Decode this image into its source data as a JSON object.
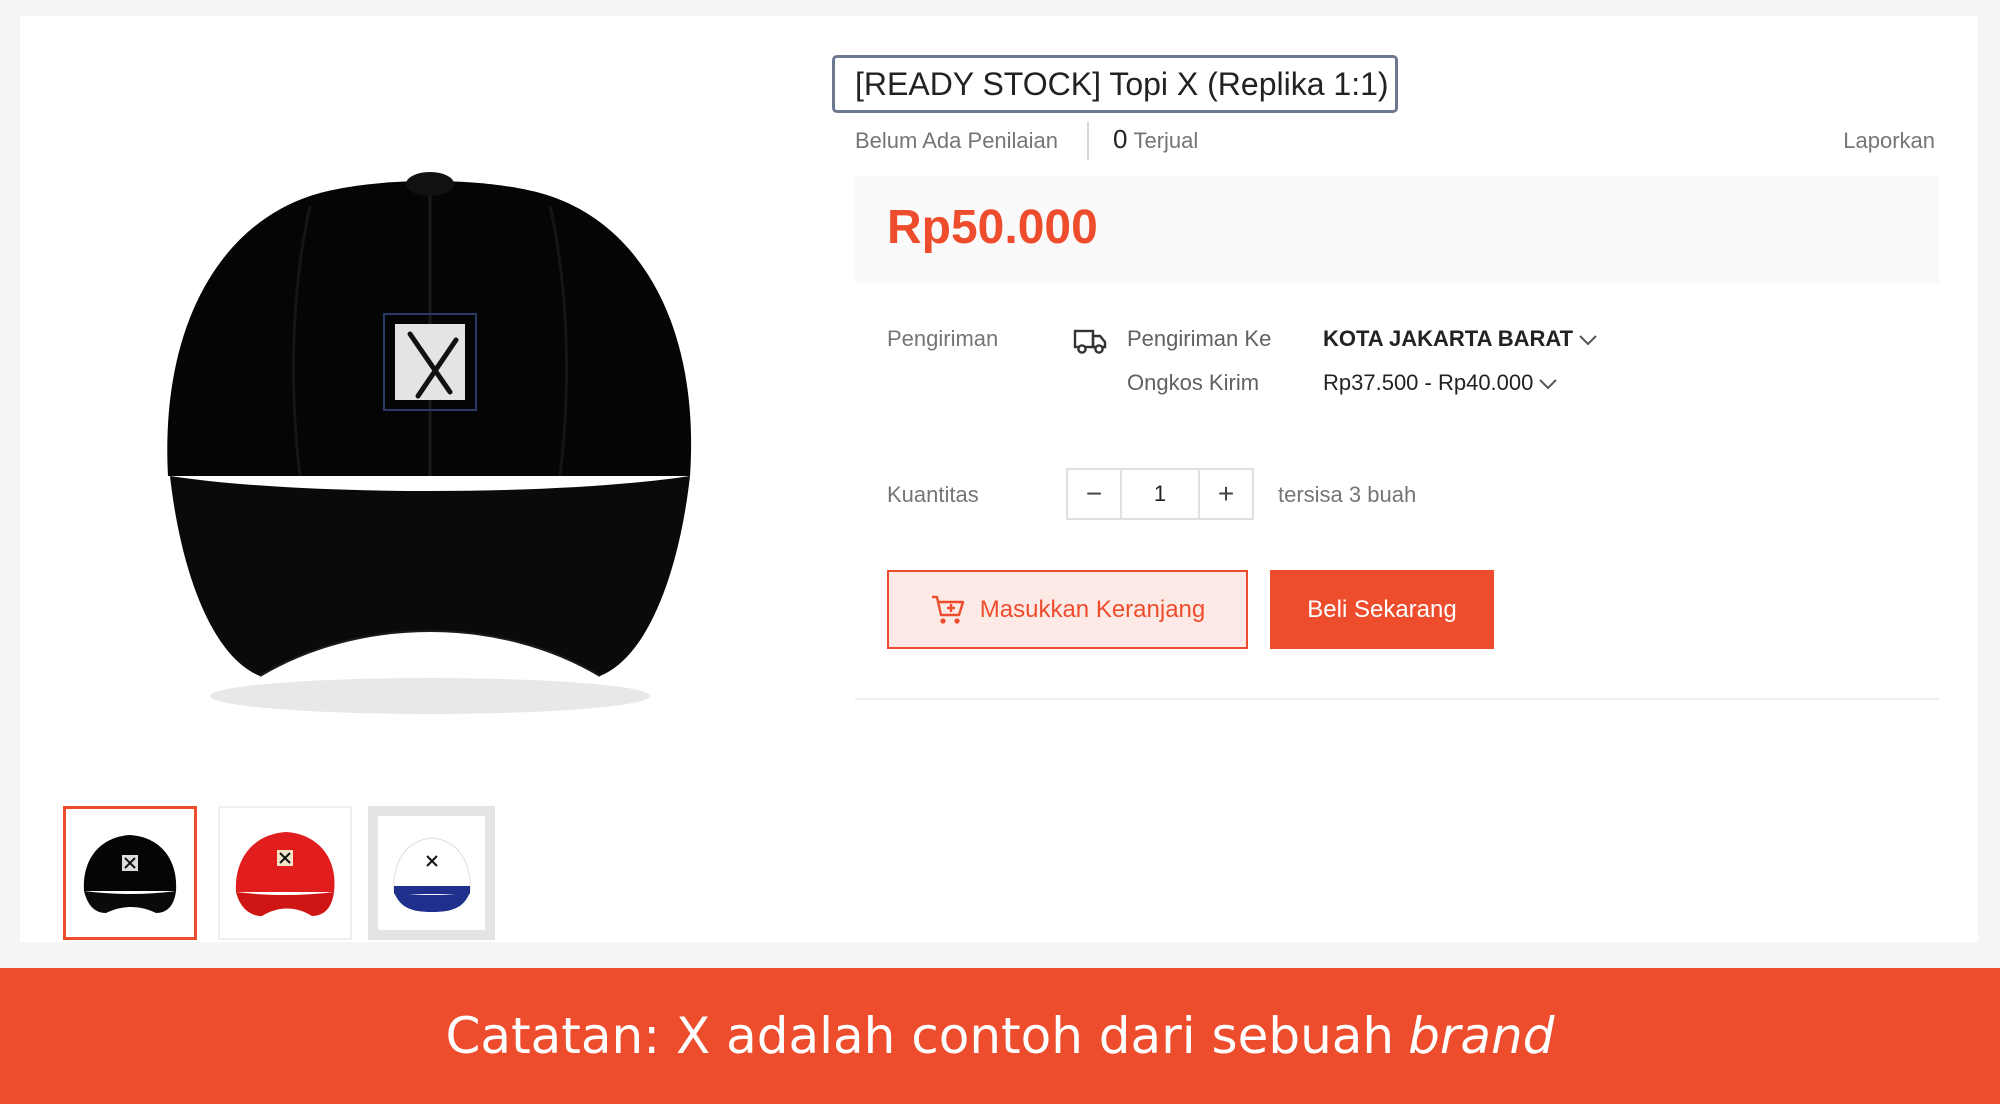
{
  "product": {
    "title": "[READY STOCK] Topi X (Replika 1:1)",
    "rating_text": "Belum Ada Penilaian",
    "sold_count": "0",
    "sold_label": "Terjual",
    "report_label": "Laporkan",
    "price": "Rp50.000",
    "main_image_icon": "black-cap-image",
    "thumbnails": [
      {
        "icon": "black-cap-thumbnail",
        "selected": true
      },
      {
        "icon": "red-cap-thumbnail",
        "selected": false
      },
      {
        "icon": "blue-white-trucker-cap-thumbnail",
        "selected": false
      }
    ]
  },
  "shipping": {
    "section_label": "Pengiriman",
    "icon": "truck-icon",
    "to_label": "Pengiriman Ke",
    "to_value": "KOTA JAKARTA BARAT",
    "cost_label": "Ongkos Kirim",
    "cost_value": "Rp37.500 - Rp40.000"
  },
  "quantity": {
    "label": "Kuantitas",
    "value": "1",
    "decrement": "−",
    "increment": "+",
    "stock_text": "tersisa 3 buah"
  },
  "actions": {
    "add_to_cart": "Masukkan Keranjang",
    "buy_now": "Beli Sekarang"
  },
  "banner": {
    "text": "Catatan: X adalah contoh dari sebuah",
    "emphasis": "brand"
  },
  "colors": {
    "accent": "#ee4d2d",
    "accent_light": "#fdeae6"
  }
}
